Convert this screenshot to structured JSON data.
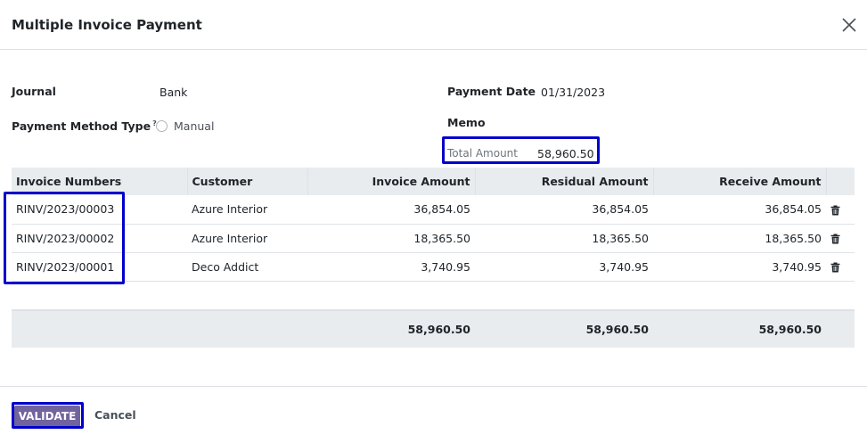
{
  "dialog": {
    "title": "Multiple Invoice Payment",
    "close_icon": "close-icon"
  },
  "form": {
    "journal_label": "Journal",
    "journal_value": "Bank",
    "payment_method_label": "Payment Method Type",
    "payment_method_help": "?",
    "payment_method_option": "Manual",
    "payment_date_label": "Payment Date",
    "payment_date_value": "01/31/2023",
    "memo_label": "Memo",
    "total_amount_label": "Total Amount",
    "total_amount_value": "58,960.50"
  },
  "table": {
    "headers": [
      "Invoice Numbers",
      "Customer",
      "Invoice Amount",
      "Residual Amount",
      "Receive Amount"
    ],
    "rows": [
      {
        "invoice": "RINV/2023/00003",
        "customer": "Azure Interior",
        "invoice_amount": "36,854.05",
        "residual_amount": "36,854.05",
        "receive_amount": "36,854.05"
      },
      {
        "invoice": "RINV/2023/00002",
        "customer": "Azure Interior",
        "invoice_amount": "18,365.50",
        "residual_amount": "18,365.50",
        "receive_amount": "18,365.50"
      },
      {
        "invoice": "RINV/2023/00001",
        "customer": "Deco Addict",
        "invoice_amount": "3,740.95",
        "residual_amount": "3,740.95",
        "receive_amount": "3,740.95"
      }
    ],
    "totals": {
      "invoice_amount": "58,960.50",
      "residual_amount": "58,960.50",
      "receive_amount": "58,960.50"
    },
    "row_action_icon": "trash-icon"
  },
  "footer": {
    "validate_label": "VALIDATE",
    "cancel_label": "Cancel"
  },
  "colors": {
    "primary": "#71639e",
    "highlight": "#0000cc",
    "header_bg": "#e9ecef"
  }
}
